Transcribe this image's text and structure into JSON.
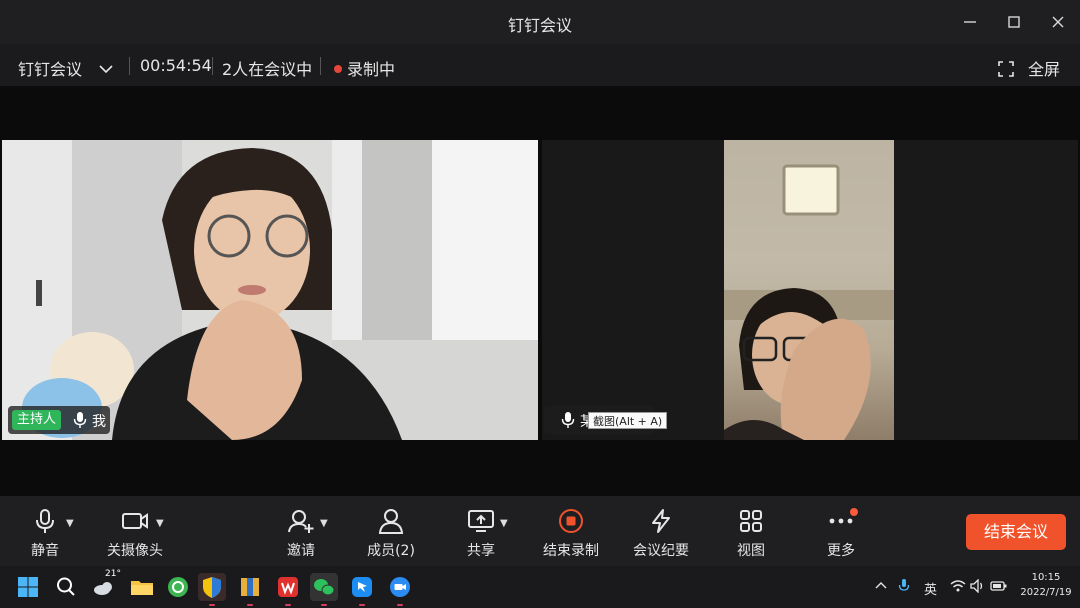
{
  "window": {
    "title": "钉钉会议"
  },
  "infobar": {
    "app_menu": "钉钉会议",
    "duration": "00:54:54",
    "participants": "2人在会议中",
    "recording": "录制中",
    "fullscreen": "全屏"
  },
  "tiles": {
    "left": {
      "host_badge": "主持人",
      "name": "我"
    },
    "right": {
      "name": "某",
      "tooltip": "截图(Alt + A)"
    }
  },
  "toolbar": {
    "mute": "静音",
    "camera_off": "关摄像头",
    "invite": "邀请",
    "members": "成员(2)",
    "share": "共享",
    "stop_record": "结束录制",
    "minutes": "会议纪要",
    "view": "视图",
    "more": "更多",
    "end_meeting": "结束会议"
  },
  "taskbar": {
    "weather_temp": "21°",
    "ime": "英",
    "time": "10:15",
    "date": "2022/7/19"
  },
  "colors": {
    "accent_end": "#f0532c",
    "host_green": "#2fb55a",
    "record_red": "#e6473c"
  }
}
